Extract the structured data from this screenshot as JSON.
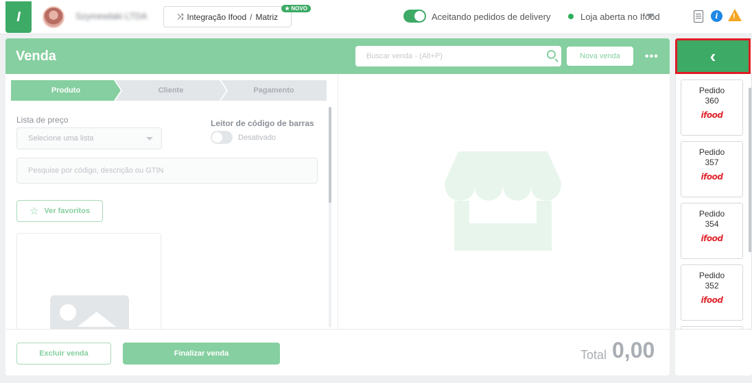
{
  "topbar": {
    "logo_text": "I",
    "company_name": "Szymewlaki LTDA",
    "integration_label": "Integração Ifood",
    "integration_separator": "/",
    "integration_target": "Matriz",
    "new_badge": "★ NOVO",
    "delivery_toggle_label": "Aceitando pedidos de delivery",
    "store_status": "Loja aberta no Ifood",
    "info_icon_glyph": "i",
    "warn_icon_glyph": "!"
  },
  "sale": {
    "title": "Venda",
    "search_placeholder": "Buscar venda - (Alt+P)",
    "new_sale_label": "Nova venda",
    "more_label": "•••",
    "steps": [
      {
        "label": "Produto"
      },
      {
        "label": "Cliente"
      },
      {
        "label": "Pagamento"
      }
    ],
    "price_list_label": "Lista de preço",
    "price_list_placeholder": "Selecione uma lista",
    "barcode_label": "Leitor de código de barras",
    "barcode_state": "Desativado",
    "product_search_placeholder": "Pesquise por código, descrição ou GTIN",
    "favorites_label": "Ver favoritos",
    "delete_label": "Excluir venda",
    "finish_label": "Finalizar venda",
    "total_label": "Total",
    "total_value": "0,00"
  },
  "orders": {
    "collapse_glyph": "‹",
    "items": [
      {
        "title": "Pedido",
        "number": "360",
        "brand": "ifood"
      },
      {
        "title": "Pedido",
        "number": "357",
        "brand": "ifood"
      },
      {
        "title": "Pedido",
        "number": "354",
        "brand": "ifood"
      },
      {
        "title": "Pedido",
        "number": "352",
        "brand": "ifood"
      }
    ]
  },
  "colors": {
    "brand_green": "#3daa66",
    "light_green": "#86cfa0",
    "ifood_red": "#e0262e",
    "highlight_red": "#e01b24"
  }
}
